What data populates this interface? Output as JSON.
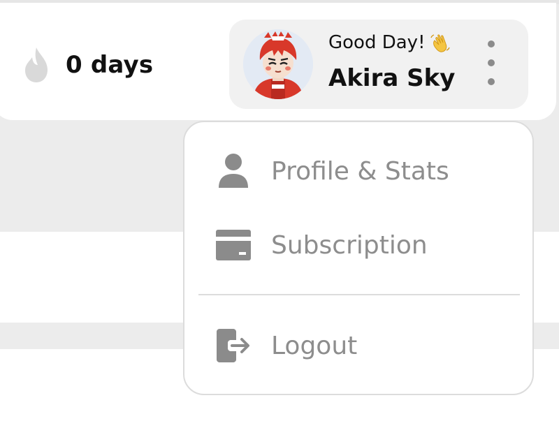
{
  "header": {
    "streak": {
      "value": "0 days",
      "icon": "flame-icon"
    },
    "user": {
      "greeting": "Good Day!",
      "greeting_emoji": "waving-hand-icon",
      "name": "Akira Sky",
      "menu_icon": "more-vertical-icon"
    }
  },
  "dropdown": {
    "items": [
      {
        "label": "Profile & Stats",
        "icon": "user-icon"
      },
      {
        "label": "Subscription",
        "icon": "credit-card-icon"
      },
      {
        "label": "Logout",
        "icon": "logout-icon"
      }
    ]
  },
  "colors": {
    "background": "#ececec",
    "card": "#f1f1f1",
    "menu_text": "#8d8d8d",
    "icon_gray": "#8b8b8b",
    "avatar_red": "#d8382a"
  }
}
